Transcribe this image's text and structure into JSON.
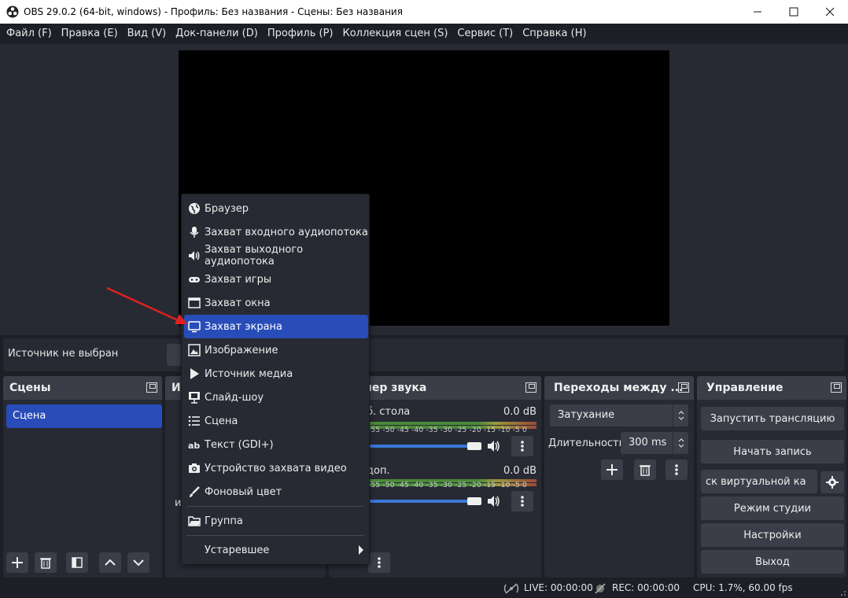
{
  "window": {
    "title": "OBS 29.0.2 (64-bit, windows) - Профиль: Без названия - Сцены: Без названия",
    "minimize": "—",
    "maximize": "☐",
    "close": "✕"
  },
  "menubar": [
    "Файл (F)",
    "Правка (E)",
    "Вид (V)",
    "Док-панели (D)",
    "Профиль (P)",
    "Коллекция сцен (S)",
    "Сервис (T)",
    "Справка (H)"
  ],
  "source_bar": {
    "no_source": "Источник не выбран"
  },
  "scenes": {
    "title": "Сцены",
    "items": [
      "Сцена"
    ]
  },
  "sources": {
    "title": "И",
    "hint": "и"
  },
  "mixer": {
    "title": "шер звука",
    "tracks": [
      {
        "name": "б. стола",
        "db": "0.0 dB",
        "volume_pct": 100
      },
      {
        "name": "доп.",
        "db": "0.0 dB",
        "volume_pct": 100
      }
    ],
    "scale": "-60 -55 -50 -45 -40 -35 -30 -25 -20 -15 -10  -5  0",
    "scale_short": "-55 -50 -45 -40 -35 -30 -25 -20 -15 -10  -5  0"
  },
  "transitions": {
    "title": "Переходы между ...",
    "selected": "Затухание",
    "duration_label": "Длительность",
    "duration_value": "300 ms"
  },
  "controls": {
    "title": "Управление",
    "buttons": [
      "Запустить трансляцию",
      "Начать запись",
      "ск виртуальной ка",
      "Режим студии",
      "Настройки",
      "Выход"
    ]
  },
  "status": {
    "live": "LIVE: 00:00:00",
    "rec": "REC: 00:00:00",
    "cpu": "CPU: 1.7%, 60.00 fps"
  },
  "context_menu": {
    "items": [
      {
        "label": "Браузер",
        "icon": "globe-icon"
      },
      {
        "label": "Захват входного аудиопотока",
        "icon": "microphone-icon"
      },
      {
        "label": "Захват выходного аудиопотока",
        "icon": "speaker-icon"
      },
      {
        "label": "Захват игры",
        "icon": "gamepad-icon"
      },
      {
        "label": "Захват окна",
        "icon": "window-icon"
      },
      {
        "label": "Захват экрана",
        "icon": "monitor-icon",
        "highlighted": true
      },
      {
        "label": "Изображение",
        "icon": "image-icon"
      },
      {
        "label": "Источник медиа",
        "icon": "play-icon"
      },
      {
        "label": "Слайд-шоу",
        "icon": "slideshow-icon"
      },
      {
        "label": "Сцена",
        "icon": "list-icon"
      },
      {
        "label": "Текст (GDI+)",
        "icon": "text-icon"
      },
      {
        "label": "Устройство захвата видео",
        "icon": "camera-icon"
      },
      {
        "label": "Фоновый цвет",
        "icon": "brush-icon"
      }
    ],
    "group": {
      "label": "Группа",
      "icon": "folder-icon"
    },
    "deprecated": {
      "label": "Устаревшее"
    }
  },
  "colors": {
    "background": "#1d1f26",
    "panel": "#272a33",
    "accent": "#284cb8",
    "annotation_arrow": "#e02020"
  }
}
